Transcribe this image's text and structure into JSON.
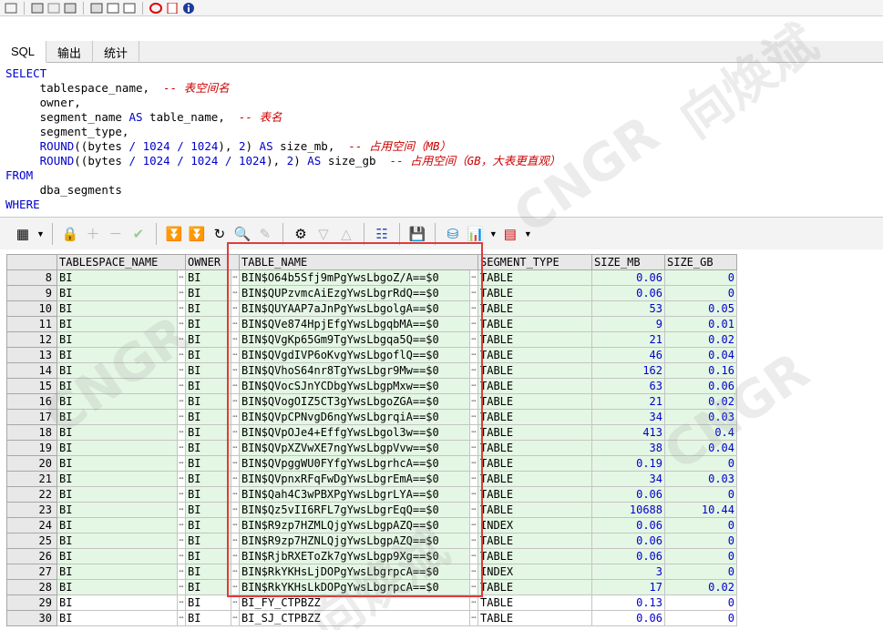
{
  "tabs": [
    "SQL",
    "输出",
    "统计"
  ],
  "sql_lines": [
    [
      {
        "t": "SELECT",
        "c": "kw"
      }
    ],
    [
      {
        "t": "     tablespace_name,  "
      },
      {
        "t": "-- 表空间名",
        "c": "cm"
      }
    ],
    [
      {
        "t": "     owner,"
      }
    ],
    [
      {
        "t": "     segment_name "
      },
      {
        "t": "AS",
        "c": "kw"
      },
      {
        "t": " table_name,  "
      },
      {
        "t": "-- 表名",
        "c": "cm"
      }
    ],
    [
      {
        "t": "     segment_type,"
      }
    ],
    [
      {
        "t": "     "
      },
      {
        "t": "ROUND",
        "c": "kw"
      },
      {
        "t": "((bytes "
      },
      {
        "t": "/",
        "c": "kw"
      },
      {
        "t": " "
      },
      {
        "t": "1024",
        "c": "num"
      },
      {
        "t": " "
      },
      {
        "t": "/",
        "c": "kw"
      },
      {
        "t": " "
      },
      {
        "t": "1024",
        "c": "num"
      },
      {
        "t": "), "
      },
      {
        "t": "2",
        "c": "num"
      },
      {
        "t": ") "
      },
      {
        "t": "AS",
        "c": "kw"
      },
      {
        "t": " size_mb,  "
      },
      {
        "t": "-- 占用空间（MB）",
        "c": "cm"
      }
    ],
    [
      {
        "t": "     "
      },
      {
        "t": "ROUND",
        "c": "kw"
      },
      {
        "t": "((bytes "
      },
      {
        "t": "/",
        "c": "kw"
      },
      {
        "t": " "
      },
      {
        "t": "1024",
        "c": "num"
      },
      {
        "t": " "
      },
      {
        "t": "/",
        "c": "kw"
      },
      {
        "t": " "
      },
      {
        "t": "1024",
        "c": "num"
      },
      {
        "t": " "
      },
      {
        "t": "/",
        "c": "kw"
      },
      {
        "t": " "
      },
      {
        "t": "1024",
        "c": "num"
      },
      {
        "t": "), "
      },
      {
        "t": "2",
        "c": "num"
      },
      {
        "t": ") "
      },
      {
        "t": "AS",
        "c": "kw"
      },
      {
        "t": " size_gb  "
      },
      {
        "t": "-- 占用空间（GB，大表更直观）",
        "c": "cm"
      }
    ],
    [
      {
        "t": "FROM",
        "c": "kw"
      }
    ],
    [
      {
        "t": "     dba_segments"
      }
    ],
    [
      {
        "t": "WHERE",
        "c": "kw"
      }
    ]
  ],
  "grid": {
    "columns": [
      "TABLESPACE_NAME",
      "OWNER",
      "TABLE_NAME",
      "SEGMENT_TYPE",
      "SIZE_MB",
      "SIZE_GB"
    ],
    "rows": [
      {
        "n": "8",
        "ts": "BI",
        "owner": "BI",
        "name": "BIN$O64b5Sfj9mPgYwsLbgoZ/A==$0",
        "type": "TABLE",
        "mb": "0.06",
        "gb": "0",
        "green": true
      },
      {
        "n": "9",
        "ts": "BI",
        "owner": "BI",
        "name": "BIN$QUPzvmcAiEzgYwsLbgrRdQ==$0",
        "type": "TABLE",
        "mb": "0.06",
        "gb": "0",
        "green": true
      },
      {
        "n": "10",
        "ts": "BI",
        "owner": "BI",
        "name": "BIN$QUYAAP7aJnPgYwsLbgolgA==$0",
        "type": "TABLE",
        "mb": "53",
        "gb": "0.05",
        "green": true
      },
      {
        "n": "11",
        "ts": "BI",
        "owner": "BI",
        "name": "BIN$QVe874HpjEfgYwsLbgqbMA==$0",
        "type": "TABLE",
        "mb": "9",
        "gb": "0.01",
        "green": true
      },
      {
        "n": "12",
        "ts": "BI",
        "owner": "BI",
        "name": "BIN$QVgKp65Gm9TgYwsLbgqa5Q==$0",
        "type": "TABLE",
        "mb": "21",
        "gb": "0.02",
        "green": true
      },
      {
        "n": "13",
        "ts": "BI",
        "owner": "BI",
        "name": "BIN$QVgdIVP6oKvgYwsLbgoflQ==$0",
        "type": "TABLE",
        "mb": "46",
        "gb": "0.04",
        "green": true
      },
      {
        "n": "14",
        "ts": "BI",
        "owner": "BI",
        "name": "BIN$QVhoS64nr8TgYwsLbgr9Mw==$0",
        "type": "TABLE",
        "mb": "162",
        "gb": "0.16",
        "green": true
      },
      {
        "n": "15",
        "ts": "BI",
        "owner": "BI",
        "name": "BIN$QVocSJnYCDbgYwsLbgpMxw==$0",
        "type": "TABLE",
        "mb": "63",
        "gb": "0.06",
        "green": true
      },
      {
        "n": "16",
        "ts": "BI",
        "owner": "BI",
        "name": "BIN$QVogOIZ5CT3gYwsLbgoZGA==$0",
        "type": "TABLE",
        "mb": "21",
        "gb": "0.02",
        "green": true
      },
      {
        "n": "17",
        "ts": "BI",
        "owner": "BI",
        "name": "BIN$QVpCPNvgD6ngYwsLbgrqiA==$0",
        "type": "TABLE",
        "mb": "34",
        "gb": "0.03",
        "green": true
      },
      {
        "n": "18",
        "ts": "BI",
        "owner": "BI",
        "name": "BIN$QVpOJe4+EffgYwsLbgol3w==$0",
        "type": "TABLE",
        "mb": "413",
        "gb": "0.4",
        "green": true
      },
      {
        "n": "19",
        "ts": "BI",
        "owner": "BI",
        "name": "BIN$QVpXZVwXE7ngYwsLbgpVvw==$0",
        "type": "TABLE",
        "mb": "38",
        "gb": "0.04",
        "green": true
      },
      {
        "n": "20",
        "ts": "BI",
        "owner": "BI",
        "name": "BIN$QVpggWU0FYfgYwsLbgrhcA==$0",
        "type": "TABLE",
        "mb": "0.19",
        "gb": "0",
        "green": true
      },
      {
        "n": "21",
        "ts": "BI",
        "owner": "BI",
        "name": "BIN$QVpnxRFqFwDgYwsLbgrEmA==$0",
        "type": "TABLE",
        "mb": "34",
        "gb": "0.03",
        "green": true
      },
      {
        "n": "22",
        "ts": "BI",
        "owner": "BI",
        "name": "BIN$Qah4C3wPBXPgYwsLbgrLYA==$0",
        "type": "TABLE",
        "mb": "0.06",
        "gb": "0",
        "green": true
      },
      {
        "n": "23",
        "ts": "BI",
        "owner": "BI",
        "name": "BIN$Qz5vII6RFL7gYwsLbgrEqQ==$0",
        "type": "TABLE",
        "mb": "10688",
        "gb": "10.44",
        "green": true
      },
      {
        "n": "24",
        "ts": "BI",
        "owner": "BI",
        "name": "BIN$R9zp7HZMLQjgYwsLbgpAZQ==$0",
        "type": "INDEX",
        "mb": "0.06",
        "gb": "0",
        "green": true
      },
      {
        "n": "25",
        "ts": "BI",
        "owner": "BI",
        "name": "BIN$R9zp7HZNLQjgYwsLbgpAZQ==$0",
        "type": "TABLE",
        "mb": "0.06",
        "gb": "0",
        "green": true
      },
      {
        "n": "26",
        "ts": "BI",
        "owner": "BI",
        "name": "BIN$RjbRXEToZk7gYwsLbgp9Xg==$0",
        "type": "TABLE",
        "mb": "0.06",
        "gb": "0",
        "green": true
      },
      {
        "n": "27",
        "ts": "BI",
        "owner": "BI",
        "name": "BIN$RkYKHsLjDOPgYwsLbgrpcA==$0",
        "type": "INDEX",
        "mb": "3",
        "gb": "0",
        "green": true
      },
      {
        "n": "28",
        "ts": "BI",
        "owner": "BI",
        "name": "BIN$RkYKHsLkDOPgYwsLbgrpcA==$0",
        "type": "TABLE",
        "mb": "17",
        "gb": "0.02",
        "green": true
      },
      {
        "n": "29",
        "ts": "BI",
        "owner": "BI",
        "name": "BI_FY_CTPBZZ",
        "type": "TABLE",
        "mb": "0.13",
        "gb": "0",
        "green": false
      },
      {
        "n": "30",
        "ts": "BI",
        "owner": "BI",
        "name": "BI_SJ_CTPBZZ",
        "type": "TABLE",
        "mb": "0.06",
        "gb": "0",
        "green": false
      }
    ]
  },
  "watermark": {
    "text": "向焕斌",
    "alt": "CNGR"
  },
  "colors": {
    "highlight": "#e03b3b",
    "row_green": "#e4f7e4",
    "keyword": "#0000cc",
    "comment": "#cc0000"
  }
}
